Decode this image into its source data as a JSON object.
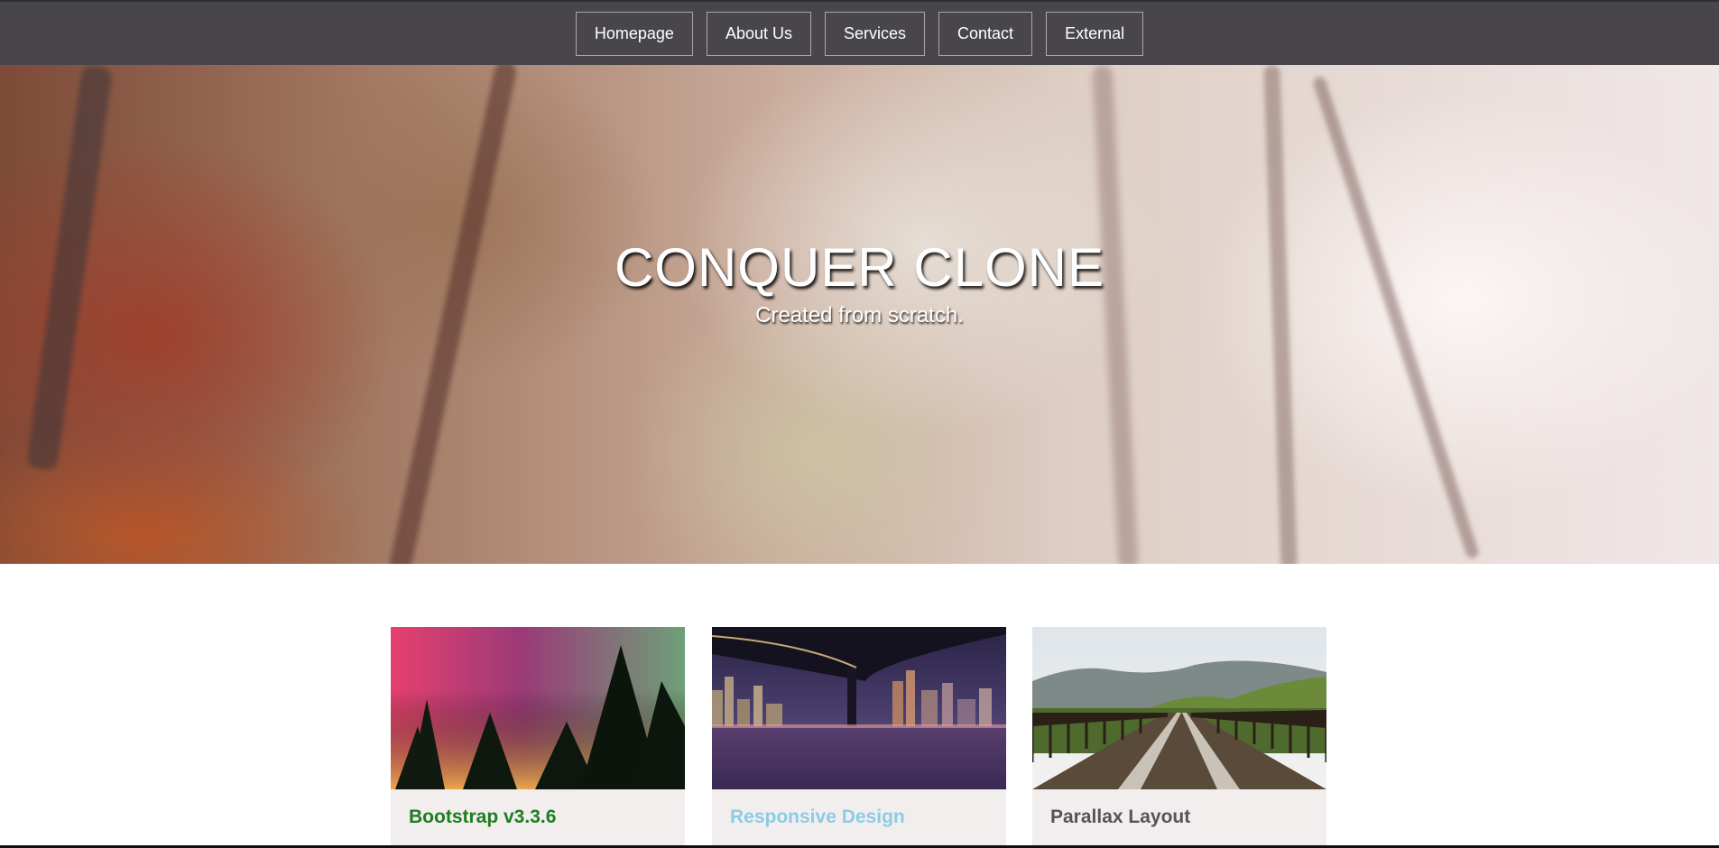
{
  "nav": {
    "items": [
      {
        "label": "Homepage"
      },
      {
        "label": "About Us"
      },
      {
        "label": "Services"
      },
      {
        "label": "Contact"
      },
      {
        "label": "External"
      }
    ]
  },
  "hero": {
    "title": "CONQUER CLONE",
    "subtitle": "Created from scratch."
  },
  "cards": [
    {
      "title": "Bootstrap v3.3.6",
      "color": "#1e7d1e",
      "image": "aurora-forest-photo"
    },
    {
      "title": "Responsive Design",
      "color": "#8ccbe6",
      "image": "city-bridge-night-photo"
    },
    {
      "title": "Parallax Layout",
      "color": "#555459",
      "image": "railway-bridge-photo"
    }
  ],
  "colors": {
    "topbar": "#48464b",
    "card_background": "#f1eeed"
  }
}
